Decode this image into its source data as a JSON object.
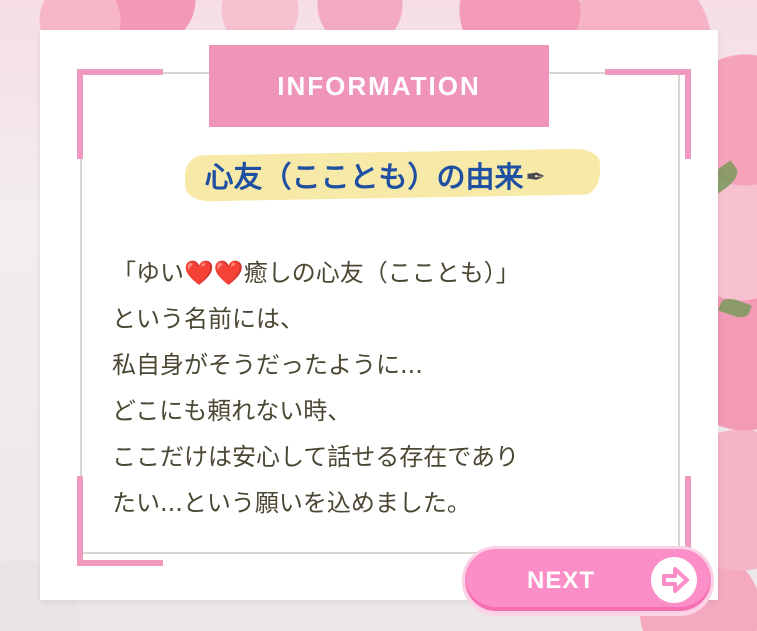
{
  "header": {
    "banner_label": "INFORMATION"
  },
  "title": {
    "text": "心友（こことも）の由来",
    "icon": "pen-icon"
  },
  "body": {
    "line1_start": "「ゆい",
    "line1_end": "癒しの心友（こことも）」",
    "heart_emoji": "❤️❤️",
    "line2": "という名前には、",
    "line3": "私自身がそうだったように...",
    "line4": "どこにも頼れない時、",
    "line5": "ここだけは安心して話せる存在であり",
    "line6": "たい...という願いを込めました。"
  },
  "footer": {
    "next_label": "NEXT",
    "next_icon": "arrow-right-circle-icon"
  },
  "colors": {
    "banner": "#ee95b9",
    "corners": "#f19ac0",
    "title": "#1e4fa2",
    "highlight": "#f7eaa8",
    "body_text": "#4b4733",
    "next_button": "#fb8ec6"
  }
}
